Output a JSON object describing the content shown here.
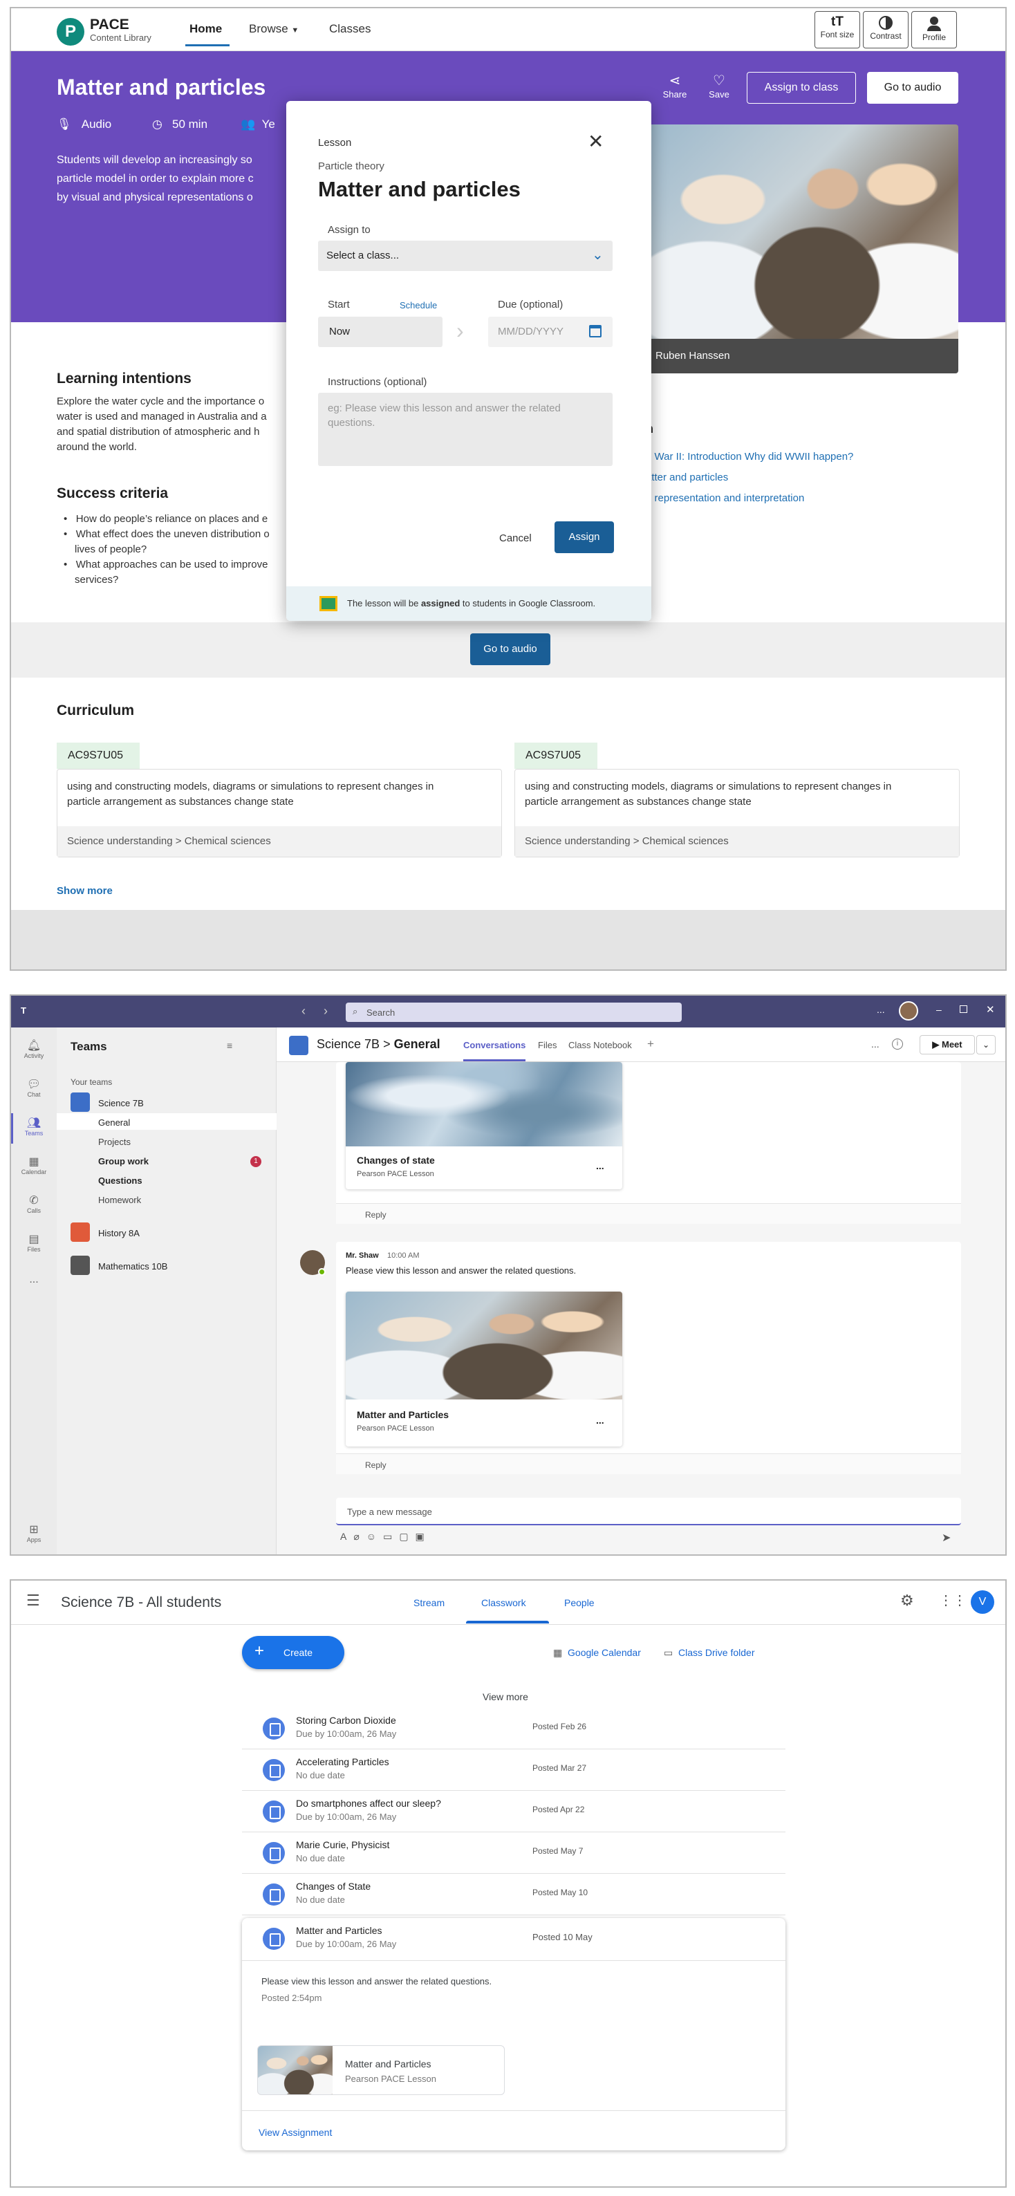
{
  "pace": {
    "logo_letter": "P",
    "logo_title": "PACE",
    "logo_sub": "Content Library",
    "nav": [
      "Home",
      "Browse",
      "Classes"
    ],
    "tools": [
      {
        "label": "Font size",
        "icon": "font-size-icon"
      },
      {
        "label": "Contrast",
        "icon": "contrast-icon"
      },
      {
        "label": "Profile",
        "icon": "profile-icon"
      }
    ],
    "hero": {
      "title": "Matter and particles",
      "meta": [
        "Audio",
        "50 min",
        "Ye"
      ],
      "desc": [
        "Students will develop an increasingly so",
        "particle model in order to explain more c",
        "by visual and physical representations o"
      ],
      "share": "Share",
      "save": "Save",
      "assign_btn": "Assign to class",
      "audio_btn": "Go to audio",
      "photo_credit": "Ruben Hanssen"
    },
    "learning": {
      "title": "Learning intentions",
      "text": [
        "Explore the water cycle and the importance o",
        "water is used and managed in Australia and a",
        "and spatial distribution of atmospheric and h",
        "around the world."
      ]
    },
    "success": {
      "title": "Success criteria",
      "items": [
        "How do people’s reliance on places and e",
        "What effect does the uneven distribution o",
        "lives of people?",
        "What approaches can be used to improve",
        "services?"
      ]
    },
    "related": {
      "heading": "n",
      "links": [
        "d War II: Introduction Why did WWII happen?",
        "atter and particles",
        "n representation and interpretation"
      ]
    },
    "go_audio": "Go to audio",
    "curriculum": {
      "title": "Curriculum",
      "cards": [
        {
          "code": "AC9S7U05",
          "text": [
            "using and constructing models, diagrams or simulations to represent changes in",
            "particle arrangement as substances change state"
          ],
          "footer": "Science understanding > Chemical sciences"
        },
        {
          "code": "AC9S7U05",
          "text": [
            "using and constructing models, diagrams or simulations to represent changes in",
            "particle arrangement as substances change state"
          ],
          "footer": "Science understanding > Chemical sciences"
        }
      ],
      "show_more": "Show more"
    },
    "modal": {
      "kind": "Lesson",
      "subtitle": "Particle theory",
      "title": "Matter and particles",
      "assign_label": "Assign to",
      "select_placeholder": "Select a class...",
      "start_label": "Start",
      "schedule": "Schedule",
      "start_value": "Now",
      "due_label": "Due (optional)",
      "due_placeholder": "MM/DD/YYYY",
      "instructions_label": "Instructions (optional)",
      "instructions_placeholder": "eg: Please view this lesson and answer the related questions.",
      "cancel": "Cancel",
      "assign": "Assign",
      "footer_pre": "The lesson will be ",
      "footer_bold": "assigned",
      "footer_post": " to students in Google Classroom."
    }
  },
  "teams": {
    "search": "Search",
    "more": "...",
    "rail": [
      "Activity",
      "Chat",
      "Teams",
      "Calendar",
      "Calls",
      "Files",
      "...",
      "Apps"
    ],
    "panel_title": "Teams",
    "your_teams": "Your teams",
    "teams": [
      {
        "name": "Science 7B",
        "color": "#3c6ec7"
      },
      {
        "name": "History 8A",
        "color": "#e05a3a"
      },
      {
        "name": "Mathematics 10B",
        "color": "#555"
      }
    ],
    "channels": [
      "General",
      "Projects",
      "Group work",
      "Questions",
      "Homework"
    ],
    "badge": "1",
    "header": {
      "team": "Science 7B",
      "sep": ">",
      "channel": "General",
      "tabs": [
        "Conversations",
        "Files",
        "Class Notebook"
      ],
      "meet": "Meet"
    },
    "post1": {
      "card_title": "Changes of state",
      "card_sub": "Pearson PACE Lesson",
      "reply": "Reply"
    },
    "post2": {
      "author": "Mr. Shaw",
      "time": "10:00 AM",
      "message": "Please view this lesson and answer the related questions.",
      "card_title": "Matter and Particles",
      "card_sub": "Pearson PACE Lesson",
      "reply": "Reply"
    },
    "compose": "Type a new message"
  },
  "classroom": {
    "title": "Science 7B - All students",
    "tabs": [
      "Stream",
      "Classwork",
      "People"
    ],
    "avatar": "V",
    "create": "Create",
    "calendar": "Google Calendar",
    "drive": "Class Drive folder",
    "view_more": "View more",
    "items": [
      {
        "title": "Storing Carbon Dioxide",
        "due": "Due by 10:00am, 26 May",
        "posted": "Posted Feb 26"
      },
      {
        "title": "Accelerating Particles",
        "due": "No due date",
        "posted": "Posted Mar 27"
      },
      {
        "title": "Do smartphones affect our sleep?",
        "due": "Due by 10:00am, 26 May",
        "posted": "Posted Apr 22"
      },
      {
        "title": "Marie Curie, Physicist",
        "due": "No due date",
        "posted": "Posted May 7"
      },
      {
        "title": "Changes of State",
        "due": "No due date",
        "posted": "Posted May 10"
      }
    ],
    "expanded": {
      "title": "Matter and Particles",
      "due": "Due by 10:00am, 26 May",
      "posted": "Posted 10 May",
      "message": "Please view this lesson and answer the related questions.",
      "time": "Posted 2:54pm",
      "att_title": "Matter and Particles",
      "att_sub": "Pearson PACE Lesson",
      "view": "View Assignment"
    }
  }
}
